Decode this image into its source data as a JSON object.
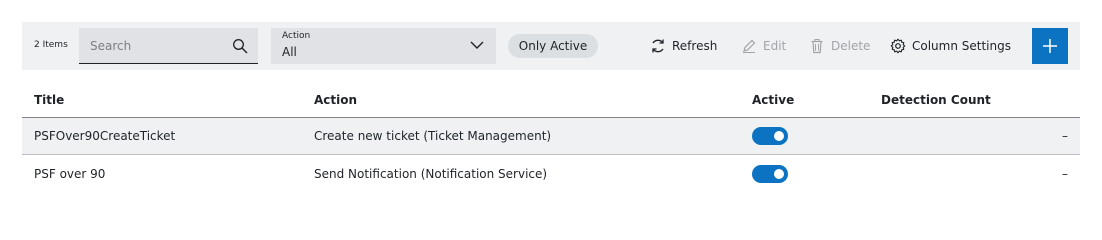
{
  "toolbar": {
    "item_count": "2 Items",
    "search_placeholder": "Search",
    "action_filter": {
      "label": "Action",
      "value": "All"
    },
    "only_active_chip": "Only Active",
    "refresh_label": "Refresh",
    "edit_label": "Edit",
    "delete_label": "Delete",
    "column_settings_label": "Column Settings",
    "accent_color": "#0b73c2"
  },
  "table": {
    "columns": [
      "Title",
      "Action",
      "Active",
      "Detection Count"
    ],
    "rows": [
      {
        "title": "PSFOver90CreateTicket",
        "action": "Create new ticket (Ticket Management)",
        "active": true,
        "detection_count": "–"
      },
      {
        "title": "PSF over 90",
        "action": "Send Notification (Notification Service)",
        "active": true,
        "detection_count": "–"
      }
    ]
  }
}
